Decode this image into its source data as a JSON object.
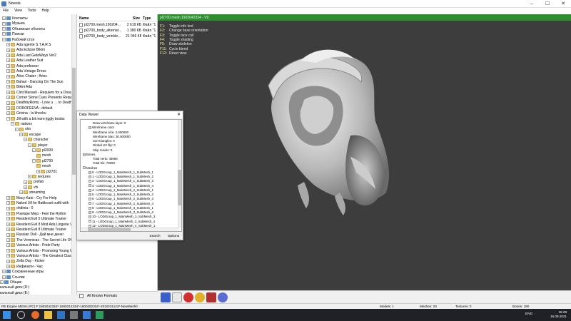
{
  "window": {
    "title": "Noesis",
    "min": "–",
    "max": "☐",
    "close": "✕"
  },
  "menu": [
    "File",
    "View",
    "Tools",
    "Help"
  ],
  "tree": [
    {
      "label": "Контакты",
      "exp": "+",
      "indent": 0,
      "icon": "spc"
    },
    {
      "label": "Музыка",
      "exp": "+",
      "indent": 0,
      "icon": "spc"
    },
    {
      "label": "Объемные объекты",
      "exp": "+",
      "indent": 0,
      "icon": "spc"
    },
    {
      "label": "Поиски",
      "exp": "+",
      "indent": 0,
      "icon": "spc"
    },
    {
      "label": "Рабочий стол",
      "exp": "−",
      "indent": 0,
      "icon": "spc"
    },
    {
      "label": "Ada agente S.T.A.R.S",
      "exp": "+",
      "indent": 1,
      "icon": "fld"
    },
    {
      "label": "Ada Eclipse Bikini",
      "exp": "+",
      "indent": 1,
      "icon": "fld"
    },
    {
      "label": "Ada Last GetaWays Ver2",
      "exp": "+",
      "indent": 1,
      "icon": "fld"
    },
    {
      "label": "Ada Leather Suit",
      "exp": "+",
      "indent": 1,
      "icon": "fld"
    },
    {
      "label": "Ada professor",
      "exp": "+",
      "indent": 1,
      "icon": "fld"
    },
    {
      "label": "Ada Vintage Dress",
      "exp": "+",
      "indent": 1,
      "icon": "fld"
    },
    {
      "label": "Alice Chater - Aries",
      "exp": "+",
      "indent": 1,
      "icon": "fld"
    },
    {
      "label": "Bahari - Dancing On The Sun",
      "exp": "+",
      "indent": 1,
      "icon": "fld"
    },
    {
      "label": "Bikini Ada",
      "exp": "+",
      "indent": 1,
      "icon": "fld"
    },
    {
      "label": "Clint Mansell - Requiem for a Dream",
      "exp": "+",
      "indent": 1,
      "icon": "fld"
    },
    {
      "label": "Corner Stone Cues Presents Requiem",
      "exp": "+",
      "indent": 1,
      "icon": "fld"
    },
    {
      "label": "DeathbyRomy - Love u → to Death",
      "exp": "+",
      "indent": 1,
      "icon": "fld"
    },
    {
      "label": "DOROFEEVA - default",
      "exp": "+",
      "indent": 1,
      "icon": "fld"
    },
    {
      "label": "Grivina - la khochu",
      "exp": "+",
      "indent": 1,
      "icon": "fld"
    },
    {
      "label": "Jill with a bit more jiggly boobs",
      "exp": "−",
      "indent": 1,
      "icon": "fld"
    },
    {
      "label": "natives",
      "exp": "−",
      "indent": 2,
      "icon": "fld"
    },
    {
      "label": "stm",
      "exp": "−",
      "indent": 3,
      "icon": "fld"
    },
    {
      "label": "escape",
      "exp": "−",
      "indent": 4,
      "icon": "fld"
    },
    {
      "label": "character",
      "exp": "−",
      "indent": 5,
      "icon": "fld"
    },
    {
      "label": "player",
      "exp": "−",
      "indent": 6,
      "icon": "fld"
    },
    {
      "label": "pl2000",
      "exp": "−",
      "indent": 7,
      "icon": "fld"
    },
    {
      "label": "mesh",
      "exp": "",
      "indent": 8,
      "icon": "fld"
    },
    {
      "label": "pl2700",
      "exp": "−",
      "indent": 7,
      "icon": "fld"
    },
    {
      "label": "mesh",
      "exp": "",
      "indent": 8,
      "icon": "fld"
    },
    {
      "label": "pl2701",
      "exp": "+",
      "indent": 8,
      "icon": "fld"
    },
    {
      "label": "textures",
      "exp": "+",
      "indent": 6,
      "icon": "fld"
    },
    {
      "label": "prefab",
      "exp": "+",
      "indent": 5,
      "icon": "fld"
    },
    {
      "label": "vfx",
      "exp": "+",
      "indent": 5,
      "icon": "fld"
    },
    {
      "label": "streaming",
      "exp": "+",
      "indent": 4,
      "icon": "fld"
    },
    {
      "label": "Macy Kate - Cry For Help",
      "exp": "+",
      "indent": 1,
      "icon": "fld"
    },
    {
      "label": "Naked Jill for Battlesuit outfit with",
      "exp": "+",
      "indent": 1,
      "icon": "fld"
    },
    {
      "label": "ohdinia - 0",
      "exp": "+",
      "indent": 1,
      "icon": "fld"
    },
    {
      "label": "Pixelspe Mejo - Feel the Rythm",
      "exp": "+",
      "indent": 1,
      "icon": "fld"
    },
    {
      "label": "Resident Evil 5 Ultimate Trainer",
      "exp": "+",
      "indent": 1,
      "icon": "fld"
    },
    {
      "label": "Resident Evil 8 Mod Ada Lingerie V",
      "exp": "+",
      "indent": 1,
      "icon": "fld"
    },
    {
      "label": "Resident Evil 8 Ultimate Trainer",
      "exp": "+",
      "indent": 1,
      "icon": "fld"
    },
    {
      "label": "Russian Doll - Дай мне денег",
      "exp": "+",
      "indent": 1,
      "icon": "fld"
    },
    {
      "label": "The Veronicas - The Secret Life Of...",
      "exp": "+",
      "indent": 1,
      "icon": "fld"
    },
    {
      "label": "Various Artists - Pride Party",
      "exp": "+",
      "indent": 1,
      "icon": "fld"
    },
    {
      "label": "Various Artists - Promising Young W",
      "exp": "+",
      "indent": 1,
      "icon": "fld"
    },
    {
      "label": "Various Artists - The Greatest Classi",
      "exp": "+",
      "indent": 1,
      "icon": "fld"
    },
    {
      "label": "Zella Day - Kicker",
      "exp": "+",
      "indent": 1,
      "icon": "fld"
    },
    {
      "label": "Инфинити - Час",
      "exp": "+",
      "indent": 1,
      "icon": "fld"
    },
    {
      "label": "Сохраненные игры",
      "exp": "+",
      "indent": 0,
      "icon": "spc"
    },
    {
      "label": "Ссылки",
      "exp": "+",
      "indent": 0,
      "icon": "spc"
    },
    {
      "label": "Общие",
      "exp": "+",
      "indent": -1,
      "icon": "spc"
    },
    {
      "label": "кальный диск (D:)",
      "exp": "",
      "indent": -1,
      "icon": "none"
    },
    {
      "label": "кальный диск (E:)",
      "exp": "",
      "indent": -1,
      "icon": "none"
    }
  ],
  "filelist": {
    "headers": {
      "name": "Name",
      "size": "Size",
      "type": "Type"
    },
    "rows": [
      {
        "name": "pl2700.mesh.190204...",
        "size": "2 619 КБ",
        "type": "Файл \"1"
      },
      {
        "name": "pl2700_body_alternat...",
        "size": "1 380 КБ",
        "type": "Файл \"1"
      },
      {
        "name": "pl2700_body_wrinkle...",
        "size": "21 046 КБ",
        "type": "Файл \"1"
      }
    ],
    "type_filter": "All Known Formats"
  },
  "viewport": {
    "title": "pl2700.mesh.1902042334 - V0",
    "keys": [
      {
        "k": "F1:",
        "t": "Toggle info text"
      },
      {
        "k": "F2:",
        "t": "Change base orientation"
      },
      {
        "k": "F3:",
        "t": "Toggle face cull"
      },
      {
        "k": "F4:",
        "t": "Toggle shading"
      },
      {
        "k": "F5:",
        "t": "Draw skeleton"
      },
      {
        "k": "F11:",
        "t": "Cycle blend"
      },
      {
        "k": "F12:",
        "t": "Reset view"
      }
    ]
  },
  "dataviewer": {
    "title": "Data Viewer",
    "close": "✕",
    "rows": [
      {
        "label": "Draw wireframe layer: 0",
        "exp": "",
        "indent": 1
      },
      {
        "label": "Wireframe color",
        "exp": "+",
        "indent": 1
      },
      {
        "label": "Wireframe size: 2.000000",
        "exp": "",
        "indent": 1
      },
      {
        "label": "Wireframe bias: 30.000000",
        "exp": "",
        "indent": 1
      },
      {
        "label": "Sort triangles: 0",
        "exp": "",
        "indent": 1
      },
      {
        "label": "Global UV flip: 0",
        "exp": "",
        "indent": 1
      },
      {
        "label": "Skip render: 0",
        "exp": "",
        "indent": 1
      },
      {
        "label": "Bones",
        "exp": "+",
        "indent": 0
      },
      {
        "label": "Total verts: 45066",
        "exp": "",
        "indent": 1
      },
      {
        "label": "Total tris: 76093",
        "exp": "",
        "indent": 1
      },
      {
        "label": "Meshes",
        "exp": "−",
        "indent": 0
      },
      {
        "label": "0 - LODGroup_1_MainMesh_1_SubMesh_1",
        "exp": "+",
        "indent": 1
      },
      {
        "label": "1 - LODGroup_1_MainMesh_1_SubMesh_2",
        "exp": "+",
        "indent": 1
      },
      {
        "label": "2 - LODGroup_1_MainMesh_1_SubMesh_3",
        "exp": "+",
        "indent": 1
      },
      {
        "label": "3 - LODGroup_1_MainMesh_1_SubMesh_4",
        "exp": "+",
        "indent": 1
      },
      {
        "label": "4 - LODGroup_1_MainMesh_2_SubMesh_1",
        "exp": "+",
        "indent": 1
      },
      {
        "label": "5 - LODGroup_1_MainMesh_2_SubMesh_2",
        "exp": "+",
        "indent": 1
      },
      {
        "label": "6 - LODGroup_1_MainMesh_2_SubMesh_3",
        "exp": "+",
        "indent": 1
      },
      {
        "label": "7 - LODGroup_1_MainMesh_2_SubMesh_4",
        "exp": "+",
        "indent": 1
      },
      {
        "label": "8 - LODGroup_1_MainMesh_3_SubMesh_1",
        "exp": "+",
        "indent": 1
      },
      {
        "label": "9 - LODGroup_1_MainMesh_3_SubMesh_2",
        "exp": "+",
        "indent": 1
      },
      {
        "label": "10 - LODGroup_1_MainMesh_3_SubMesh_3",
        "exp": "+",
        "indent": 1
      },
      {
        "label": "11 - LODGroup_1_MainMesh_3_SubMesh_4",
        "exp": "+",
        "indent": 1
      },
      {
        "label": "12 - LODGroup_1_MainMesh_4_SubMesh_1",
        "exp": "+",
        "indent": 1
      }
    ],
    "search_button": "Search",
    "options_button": "Options"
  },
  "statusbar": {
    "path": "RE Engine MESH (PC) F:1902042334*-1600312334*-1600282334*-2010231143*-NewMesh0",
    "models": "Models: 1",
    "meshes": "Meshes: 28",
    "textures": "Textures: 0",
    "bones": "Bones: 190"
  },
  "taskbar": {
    "time": "15:28",
    "date": "16.09.2021",
    "lang": "ENG"
  },
  "colors": {
    "accent": "#2f8f2f",
    "viewport_bg": "#3d3d3d",
    "taskbar": "#1f2127"
  }
}
